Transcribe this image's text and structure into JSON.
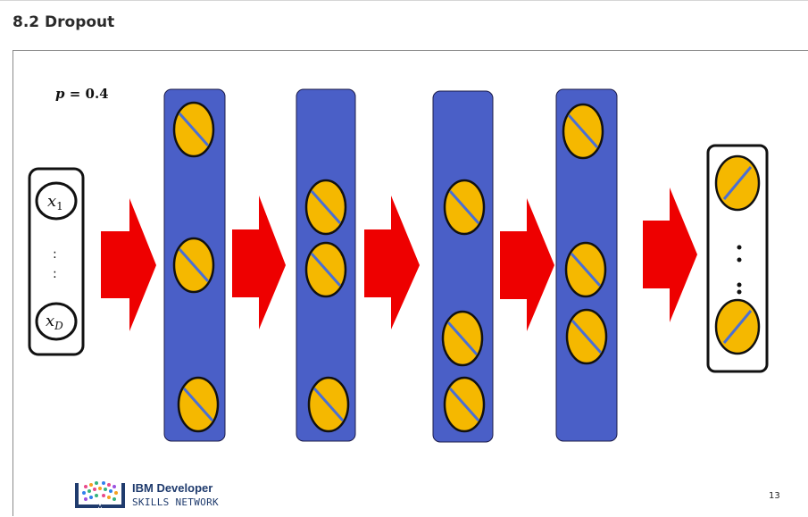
{
  "page": {
    "title": "8.2 Dropout",
    "page_number": "13"
  },
  "slide": {
    "dropout_label": "p = 0.4",
    "dropout_var": "p",
    "dropout_value": "0.4",
    "input": {
      "top": "x",
      "top_sub": "1",
      "bottom": "x",
      "bottom_sub": "D",
      "dots": ":   :"
    },
    "output_dots": ": :",
    "layer_count": 4,
    "colors": {
      "layer": "#4a5fc7",
      "neuron": "#f5b800",
      "arrow": "#ee0000",
      "dropped_line": "#4a6fd4"
    }
  },
  "logo": {
    "line1": "IBM Developer",
    "line2": "SKILLS NETWORK"
  }
}
